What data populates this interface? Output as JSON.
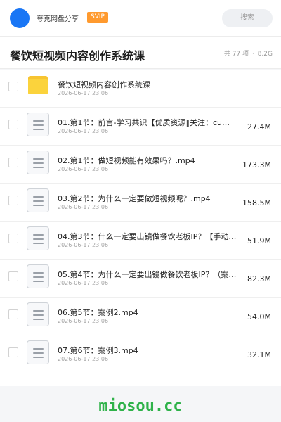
{
  "header": {
    "brand": "夸克网盘分享",
    "badge": "SVIP",
    "search_label": "搜索"
  },
  "folder": {
    "title": "餐饮短视频内容创作系统课",
    "count_label": "共 77 项",
    "separator": "·",
    "total_size": "8.2G"
  },
  "items": [
    {
      "name": "餐饮短视频内容创作系统课",
      "date": "2026-06-17 23:06",
      "size": "",
      "type": "folder",
      "icon": "folder-icon"
    },
    {
      "name": "01.第1节：前言-学习共识【优质资源‖关注：cu…",
      "date": "2026-06-17 23:06",
      "size": "27.4M",
      "type": "file",
      "icon": "document-icon"
    },
    {
      "name": "02.第1节：做短视频能有效果吗？.mp4",
      "date": "2026-06-17 23:06",
      "size": "173.3M",
      "type": "file",
      "icon": "document-icon"
    },
    {
      "name": "03.第2节：为什么一定要做短视频呢？.mp4",
      "date": "2026-06-17 23:06",
      "size": "158.5M",
      "type": "file",
      "icon": "document-icon"
    },
    {
      "name": "04.第3节：什么一定要出镜做餐饮老板IP？【手动…",
      "date": "2026-06-17 23:06",
      "size": "51.9M",
      "type": "file",
      "icon": "document-icon"
    },
    {
      "name": "05.第4节：为什么一定要出镜做餐饮老板IP？（案…",
      "date": "2026-06-17 23:06",
      "size": "82.3M",
      "type": "file",
      "icon": "document-icon"
    },
    {
      "name": "06.第5节：案例2.mp4",
      "date": "2026-06-17 23:06",
      "size": "54.0M",
      "type": "file",
      "icon": "document-icon"
    },
    {
      "name": "07.第6节：案例3.mp4",
      "date": "2026-06-17 23:06",
      "size": "32.1M",
      "type": "file",
      "icon": "document-icon"
    }
  ],
  "watermark": "miosou.cc"
}
